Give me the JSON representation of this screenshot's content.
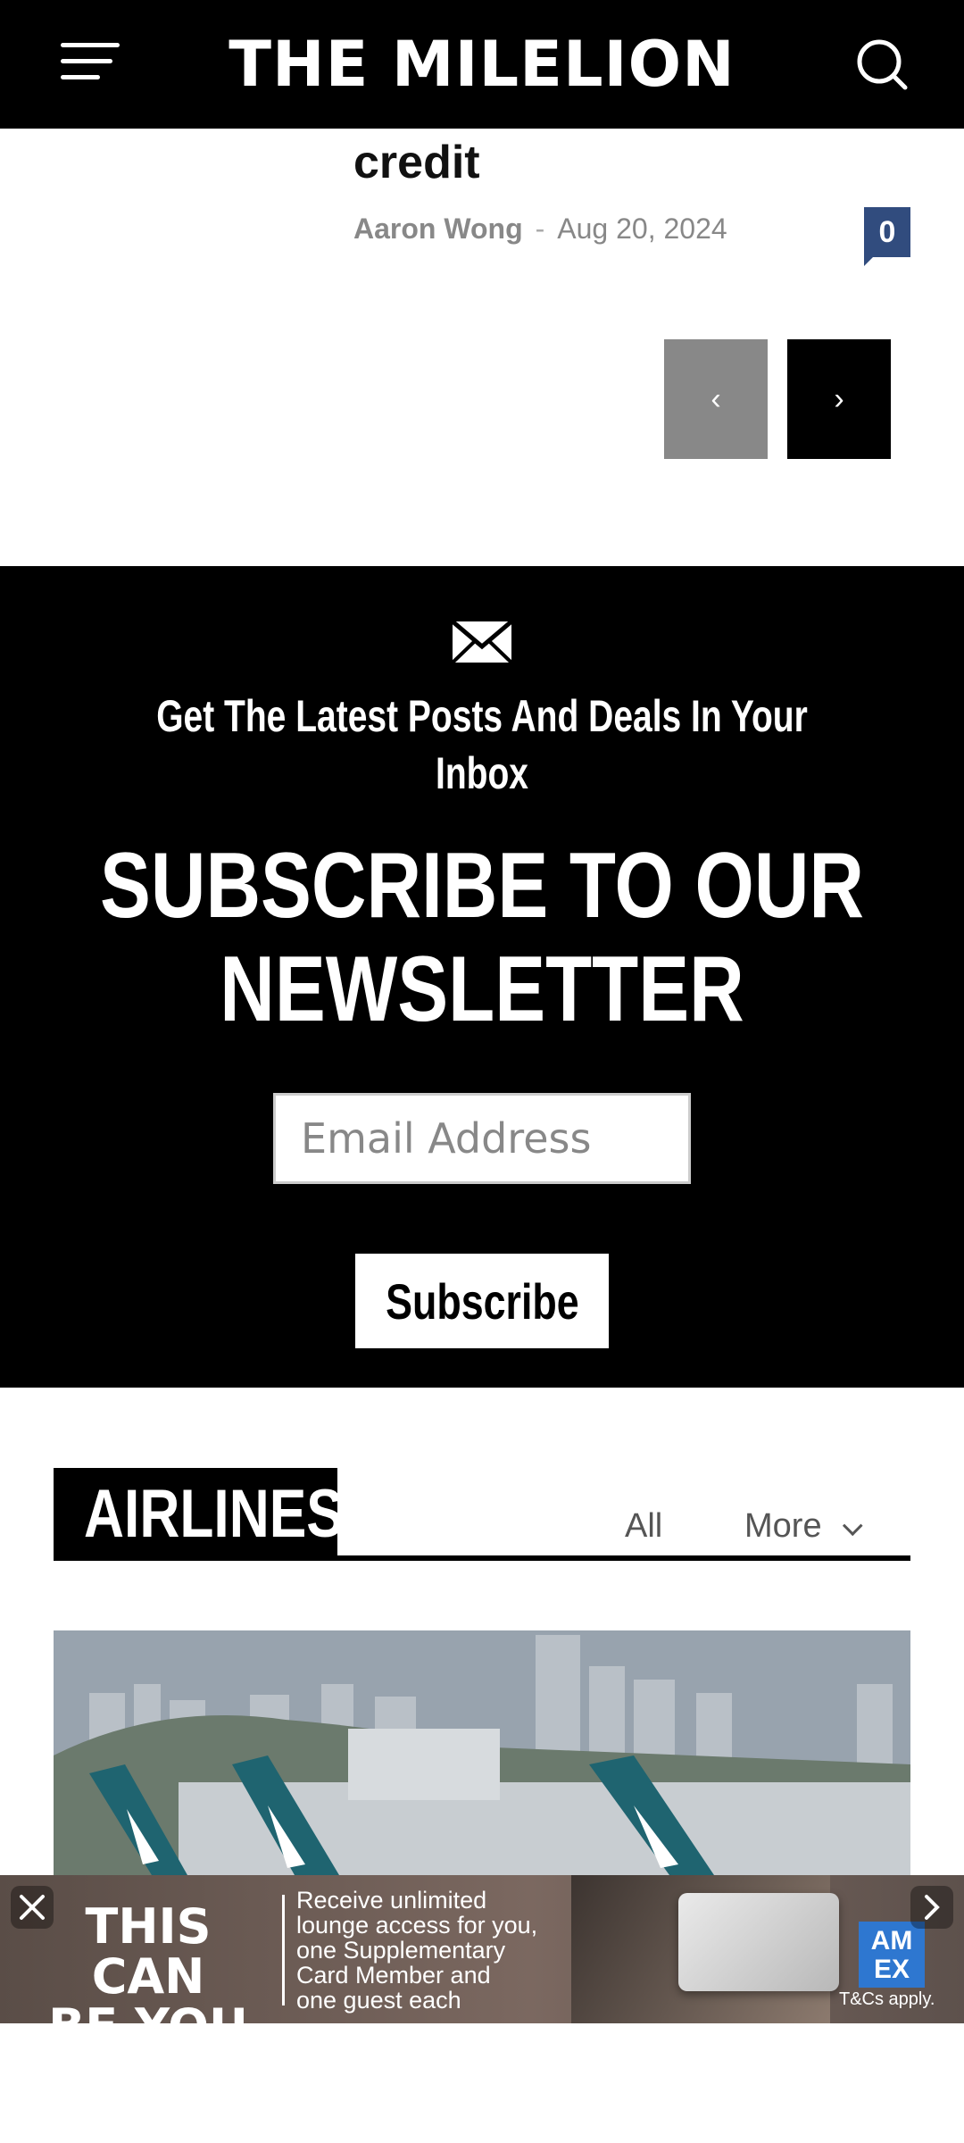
{
  "header": {
    "logo": "THE MILELION",
    "menu_icon": "hamburger-icon",
    "search_icon": "search-icon"
  },
  "article": {
    "title_fragment": "credit",
    "author": "Aaron Wong",
    "separator": "-",
    "date": "Aug 20, 2024",
    "comments": "0"
  },
  "pager": {
    "prev": "‹",
    "next": "›"
  },
  "newsletter": {
    "icon": "envelope-icon",
    "tagline": "Get The Latest Posts And Deals In Your Inbox",
    "headline_line1": "SUBSCRIBE TO OUR",
    "headline_line2": "NEWSLETTER",
    "email_placeholder": "Email Address",
    "button": "Subscribe"
  },
  "section": {
    "title": "AIRLINES",
    "tab_all": "All",
    "tab_more": "More"
  },
  "ad": {
    "headline_line1": "THIS CAN",
    "headline_line2": "BE YOU",
    "body_line1": "Receive unlimited",
    "body_line2": "lounge access for you,",
    "body_line3": "one Supplementary",
    "body_line4": "Card Member and",
    "body_line5": "one guest each",
    "logo_line1": "AM",
    "logo_line2": "EX",
    "terms": "T&Cs apply."
  },
  "colors": {
    "comment_badge": "#314c7e",
    "amex_blue": "#2e77d0"
  }
}
